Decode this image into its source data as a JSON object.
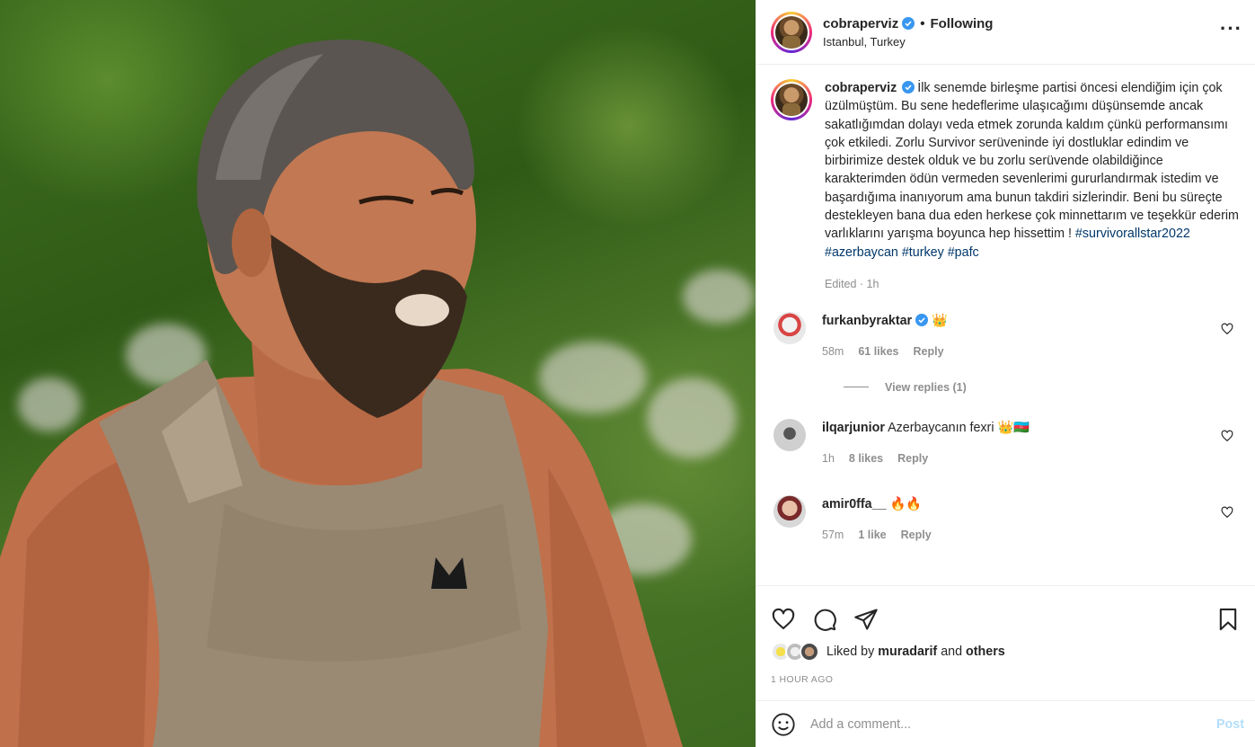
{
  "post": {
    "author": "cobraperviz",
    "verified": true,
    "follow_status": "Following",
    "location": "Istanbul, Turkey",
    "more_icon": "more-options-icon",
    "photo_alt": "Bearded man covered in mud wearing a Kappa tank top outdoors"
  },
  "caption": {
    "username": "cobraperviz",
    "text": "İlk senemde birleşme partisi öncesi elendiğim için çok üzülmüştüm. Bu sene hedeflerime ulaşıcağımı düşünsemde ancak sakatlığımdan dolayı veda etmek zorunda kaldım çünkü performansımı çok etkiledi. Zorlu Survivor serüveninde iyi dostluklar edindim ve birbirimize destek olduk ve bu zorlu serüvende olabildiğince karakterimden ödün vermeden sevenlerimi gururlandırmak istedim ve başardığıma inanıyorum ama bunun takdiri sizlerindir. Beni bu süreçte destekleyen bana dua eden herkese çok minnettarım ve teşekkür ederim varlıklarını yarışma boyunca hep hissettim ! ",
    "hashtags": [
      "#survivorallstar2022",
      "#azerbaycan",
      "#turkey",
      "#pafc"
    ],
    "edited": "Edited · 1h"
  },
  "comments": [
    {
      "username": "furkanbyraktar",
      "verified": true,
      "text": "👑",
      "time": "58m",
      "likes": "61 likes",
      "reply": "Reply",
      "view_replies": "View replies (1)"
    },
    {
      "username": "ilqarjunior",
      "verified": false,
      "text": "Azerbaycanın fexri 👑🇦🇿",
      "time": "1h",
      "likes": "8 likes",
      "reply": "Reply"
    },
    {
      "username": "amir0ffa__",
      "verified": false,
      "text": "🔥🔥",
      "time": "57m",
      "likes": "1 like",
      "reply": "Reply"
    }
  ],
  "actions": {
    "liked_by_prefix": "Liked by ",
    "liked_by_user": "muradarif",
    "liked_by_and": " and ",
    "liked_by_others": "others",
    "time_ago": "1 HOUR AGO"
  },
  "add_comment": {
    "placeholder": "Add a comment...",
    "post_label": "Post"
  },
  "colors": {
    "verified": "#3897f0",
    "hashtag": "#00376b",
    "muted": "#8e8e8e",
    "post_disabled": "#b2dffc"
  }
}
